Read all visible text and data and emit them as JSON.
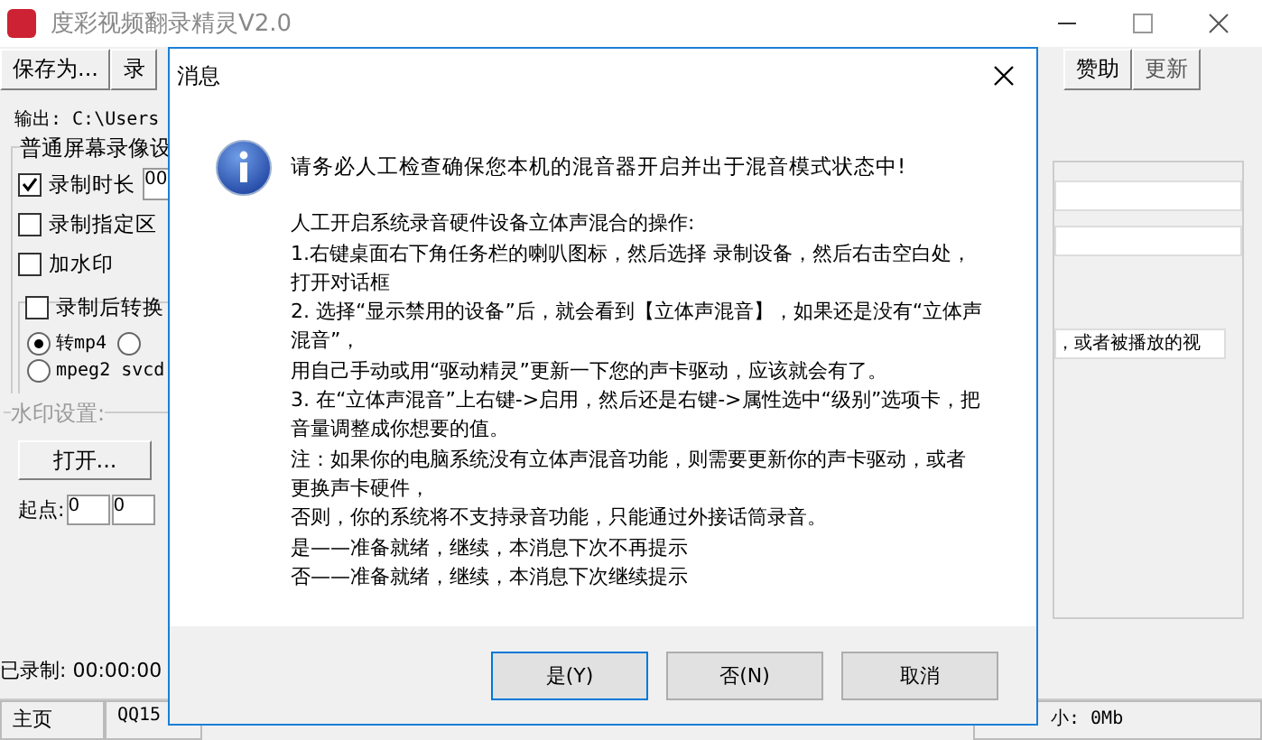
{
  "window": {
    "title": "度彩视频翻录精灵V2.0"
  },
  "toolbar": {
    "left_buttons": [
      "保存为...",
      "录"
    ],
    "right_buttons": [
      "赞助",
      "更新"
    ]
  },
  "output_path": "输出: C:\\Users",
  "screen_group": {
    "title": "普通屏幕录像设",
    "options": [
      {
        "label": "录制时长",
        "checked": true,
        "value": "00"
      },
      {
        "label": "录制指定区",
        "checked": false
      },
      {
        "label": "加水印",
        "checked": false
      }
    ]
  },
  "convert_group": {
    "label": "录制后转换",
    "checked": false,
    "formats": [
      {
        "label": "转mp4",
        "selected": true
      },
      {
        "selected": false
      },
      {
        "label": "mpeg2 svcd",
        "selected": false
      }
    ]
  },
  "watermark_group": {
    "title": "水印设置:",
    "open_button": "打开...",
    "start_label": "起点:",
    "start_values": [
      "0",
      "0"
    ]
  },
  "recorded": "已录制: 00:00:00",
  "right_panel": {
    "fields": [
      {
        "kind": "empty"
      },
      {
        "kind": "empty"
      },
      {
        "kind": "text",
        "value": "，或者被播放的视"
      }
    ]
  },
  "status_bar": [
    "主页",
    "QQ15",
    "小: 0Mb"
  ],
  "dialog": {
    "title": "消息",
    "headline": "请务必人工检查确保您本机的混音器开启并出于混音模式状态中!",
    "lines": [
      "人工开启系统录音硬件设备立体声混合的操作:",
      "1.右键桌面右下角任务栏的喇叭图标，然后选择 录制设备，然后右击空白处，",
      "打开对话框",
      "2. 选择“显示禁用的设备”后，就会看到【立体声混音】，如果还是没有“立体声",
      "混音”，",
      "用自己手动或用“驱动精灵”更新一下您的声卡驱动，应该就会有了。",
      "3. 在“立体声混音”上右键->启用，然后还是右键->属性选中“级别”选项卡，把",
      "音量调整成你想要的值。",
      "注：如果你的电脑系统没有立体声混音功能，则需要更新你的声卡驱动，或者",
      "更换声卡硬件，",
      "否则，你的系统将不支持录音功能，只能通过外接话筒录音。",
      "是——准备就绪，继续，本消息下次不再提示",
      "否——准备就绪，继续，本消息下次继续提示"
    ],
    "buttons": [
      "是(Y)",
      "否(N)",
      "取消"
    ]
  }
}
